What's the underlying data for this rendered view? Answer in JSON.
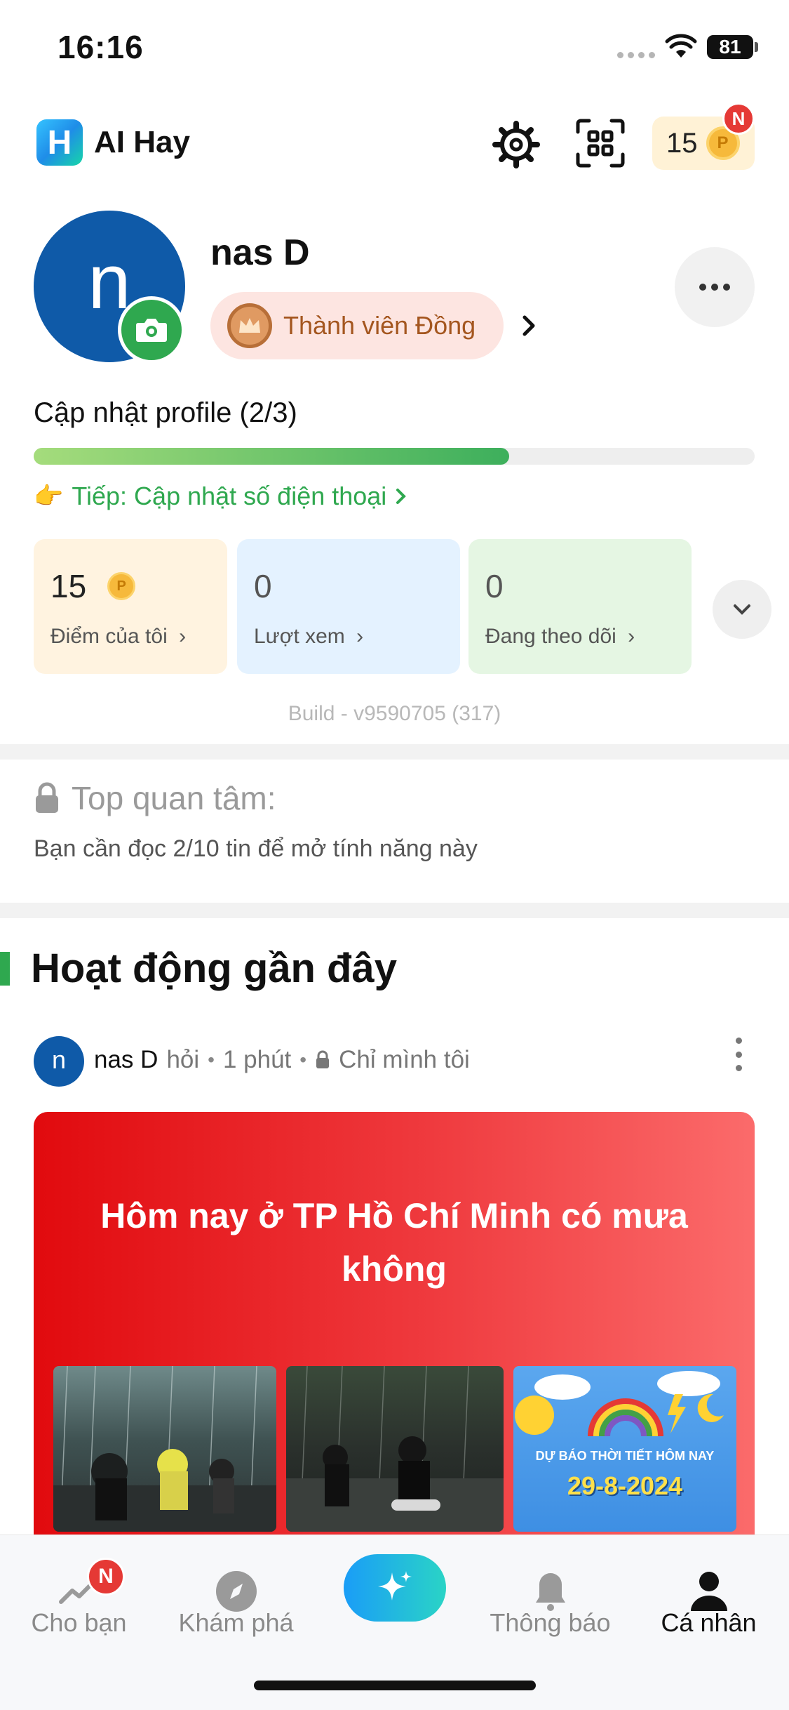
{
  "status_bar": {
    "time": "16:16",
    "battery": "81"
  },
  "header": {
    "app_name": "AI Hay",
    "logo_letter": "H",
    "coins": "15",
    "coin_symbol": "P",
    "badge": "N"
  },
  "profile": {
    "avatar_letter": "n",
    "name": "nas D",
    "member_level": "Thành viên Đồng",
    "update_title": "Cập nhật profile (2/3)",
    "update_progress": 0.66,
    "next_step": "Tiếp: Cập nhật số điện thoại"
  },
  "stats": {
    "points": {
      "value": "15",
      "label": "Điểm của tôi"
    },
    "views": {
      "value": "0",
      "label": "Lượt xem"
    },
    "following": {
      "value": "0",
      "label": "Đang theo dõi"
    }
  },
  "build": "Build - v9590705  (317)",
  "top_interest": {
    "title": "Top quan tâm:",
    "desc": "Bạn cần đọc 2/10 tin để mở tính năng này"
  },
  "recent": {
    "title": "Hoạt động gần đây",
    "post": {
      "author_initial": "n",
      "author": "nas D",
      "action": "hỏi",
      "time": "1 phút",
      "privacy": "Chỉ mình tôi",
      "question": "Hôm nay ở TP Hồ Chí Minh có mưa không",
      "thumb3_title": "DỰ BÁO THỜI TIẾT HÔM NAY",
      "thumb3_date": "29-8-2024"
    }
  },
  "nav": {
    "for_you": "Cho bạn",
    "for_you_badge": "N",
    "explore": "Khám phá",
    "notifications": "Thông báo",
    "personal": "Cá nhân"
  },
  "colors": {
    "accent_green": "#2fa84f",
    "card_red": "#e10a0e",
    "avatar_blue": "#0f5aa8"
  }
}
